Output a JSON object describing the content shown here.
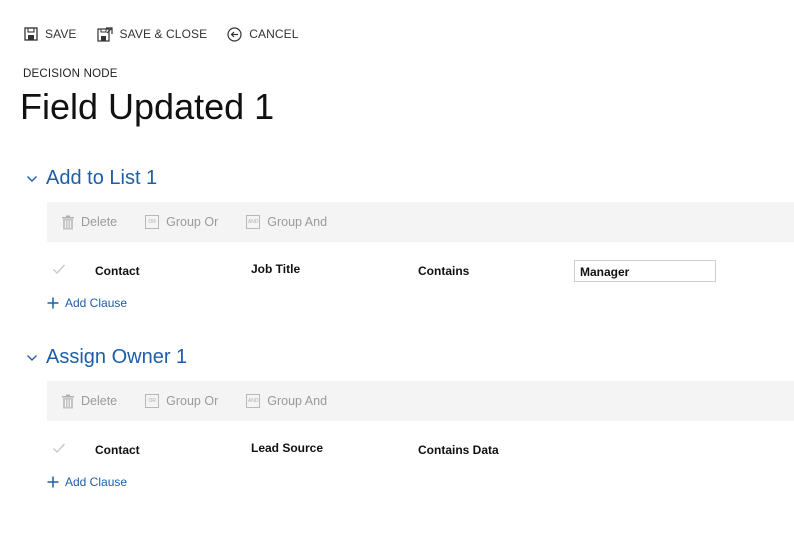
{
  "commands": {
    "save": "SAVE",
    "save_close": "SAVE & CLOSE",
    "cancel": "CANCEL"
  },
  "header": {
    "subtitle": "DECISION NODE",
    "title": "Field Updated 1"
  },
  "sections": [
    {
      "title": "Add to List 1",
      "toolbar": {
        "delete": "Delete",
        "group_or": "Group Or",
        "group_and": "Group And",
        "or_icon_text": "OR",
        "and_icon_text": "AND"
      },
      "row": {
        "entity": "Contact",
        "field": "Job Title",
        "operator": "Contains",
        "value": "Manager"
      },
      "add_clause": "Add Clause"
    },
    {
      "title": "Assign Owner 1",
      "toolbar": {
        "delete": "Delete",
        "group_or": "Group Or",
        "group_and": "Group And",
        "or_icon_text": "OR",
        "and_icon_text": "AND"
      },
      "row": {
        "entity": "Contact",
        "field": "Lead Source",
        "operator": "Contains Data"
      },
      "add_clause": "Add Clause"
    }
  ],
  "colors": {
    "accent": "#1e5ea8",
    "toolbar_bg": "#f4f4f4",
    "disabled_text": "#9a9a9a"
  }
}
